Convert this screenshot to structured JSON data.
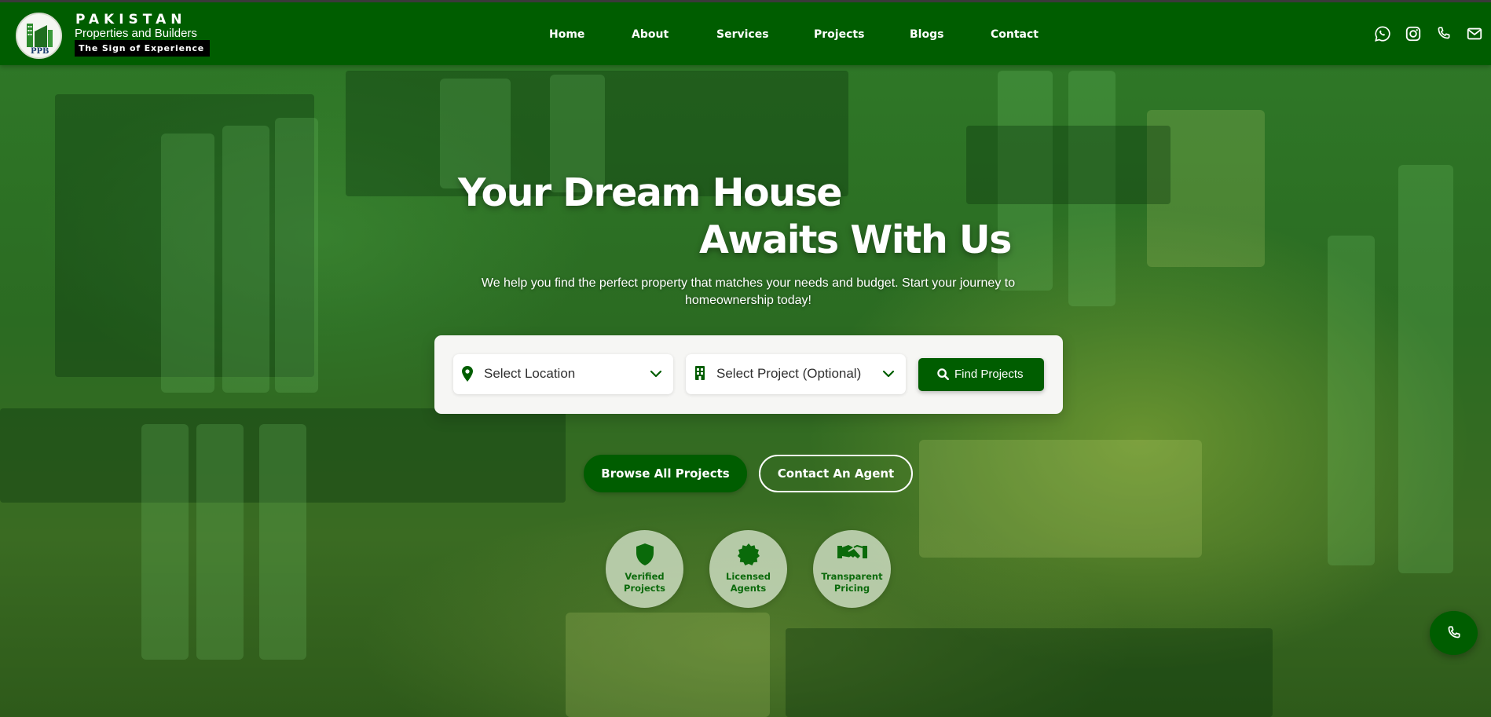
{
  "brand": {
    "logo_text": "PPB",
    "title": "PAKISTAN",
    "subtitle": "Properties and Builders",
    "tagline": "The Sign of Experience",
    "colors": {
      "primary": "#005d00",
      "tag_bg": "#000000"
    }
  },
  "nav": {
    "items": [
      {
        "label": "Home"
      },
      {
        "label": "About"
      },
      {
        "label": "Services"
      },
      {
        "label": "Projects"
      },
      {
        "label": "Blogs"
      },
      {
        "label": "Contact"
      }
    ]
  },
  "social": {
    "icons": [
      "whatsapp-icon",
      "instagram-icon",
      "phone-icon",
      "mail-icon"
    ]
  },
  "hero": {
    "headline_line1": "Your Dream House",
    "headline_line2": "Awaits With Us",
    "subtext": "We help you find the perfect property that matches your needs and budget. Start your journey to homeownership today!"
  },
  "search": {
    "location_placeholder": "Select Location",
    "project_placeholder": "Select Project (Optional)",
    "find_label": "Find Projects",
    "icons": [
      "map-pin-icon",
      "building-icon",
      "search-icon",
      "chevron-down-icon"
    ]
  },
  "cta": {
    "browse_label": "Browse All Projects",
    "contact_label": "Contact An Agent"
  },
  "features": {
    "items": [
      {
        "line1": "Verified",
        "line2": "Projects",
        "icon": "shield-icon"
      },
      {
        "line1": "Licensed",
        "line2": "Agents",
        "icon": "seal-badge-icon"
      },
      {
        "line1": "Transparent",
        "line2": "Pricing",
        "icon": "handshake-icon"
      }
    ]
  },
  "fab": {
    "icon": "phone-icon"
  }
}
